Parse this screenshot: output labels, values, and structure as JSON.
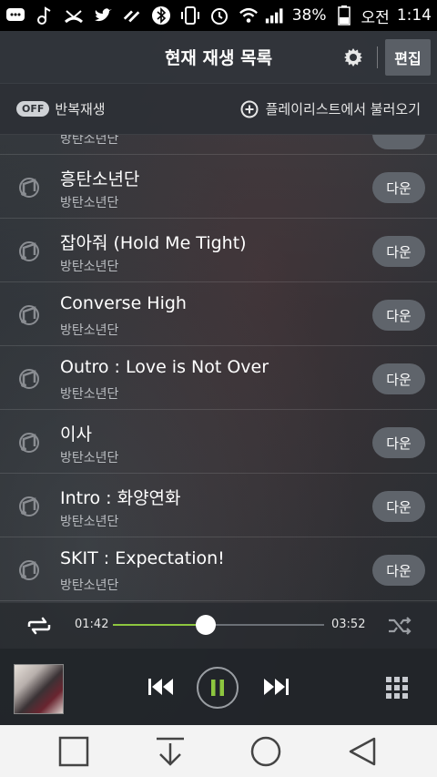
{
  "status_bar": {
    "battery": "38%",
    "ampm": "오전",
    "time": "1:14"
  },
  "header": {
    "title": "현재 재생 목록",
    "edit_label": "편집"
  },
  "subbar": {
    "repeat_badge": "OFF",
    "repeat_label": "반복재생",
    "load_label": "플레이리스트에서 불러오기"
  },
  "playlist": {
    "partial_artist": "방탄소년단",
    "down_label": "다운",
    "tracks": [
      {
        "title": "흥탄소년단",
        "artist": "방탄소년단"
      },
      {
        "title": "잡아줘 (Hold Me Tight)",
        "artist": "방탄소년단"
      },
      {
        "title": "Converse High",
        "artist": "방탄소년단"
      },
      {
        "title": "Outro : Love is Not Over",
        "artist": "방탄소년단"
      },
      {
        "title": "이사",
        "artist": "방탄소년단"
      },
      {
        "title": "Intro : 화양연화",
        "artist": "방탄소년단"
      },
      {
        "title": "SKIT : Expectation!",
        "artist": "방탄소년단"
      }
    ]
  },
  "player": {
    "current_time": "01:42",
    "total_time": "03:52",
    "progress": 0.44,
    "accent_color": "#8dc63f"
  },
  "icons": {
    "settings": "gear-icon",
    "load": "plus-circle-icon",
    "repeat": "repeat-icon",
    "shuffle": "shuffle-icon",
    "prev": "skip-previous-icon",
    "pause": "pause-icon",
    "next": "skip-next-icon",
    "grid": "grid-icon",
    "note": "music-note-icon"
  }
}
